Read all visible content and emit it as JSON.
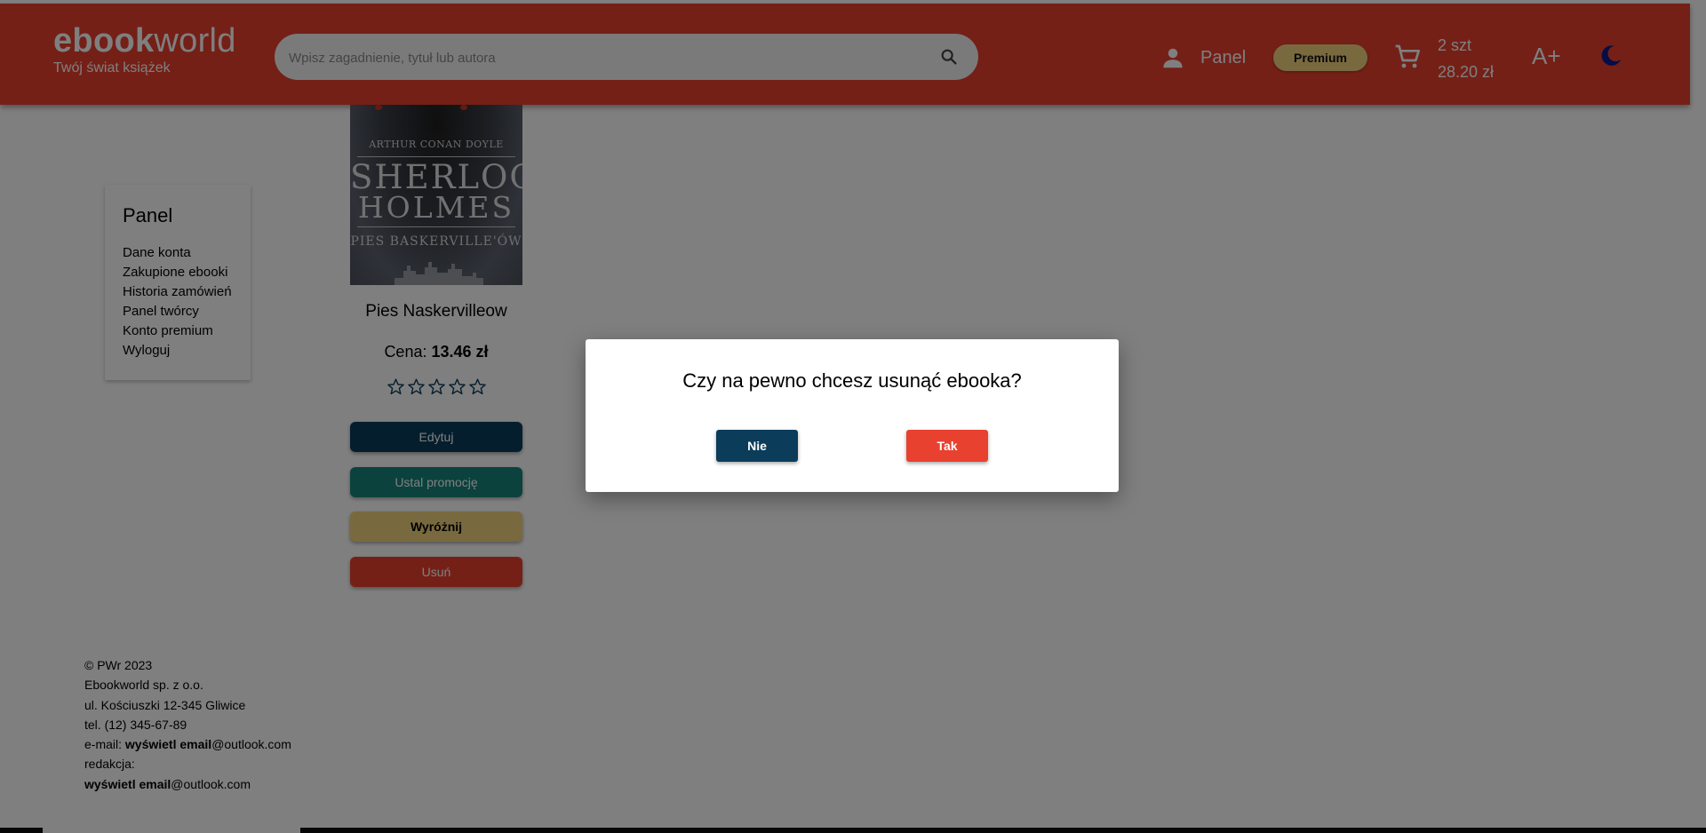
{
  "header": {
    "logo_bold": "ebook",
    "logo_light": "world",
    "tagline": "Twój świat książek",
    "search_placeholder": "Wpisz zagadnienie, tytuł lub autora",
    "panel_label": "Panel",
    "premium_label": "Premium",
    "cart_count": "2 szt",
    "cart_total": "28.20 zł",
    "font_size_label": "A+",
    "colors": {
      "bar": "#e8412f",
      "premium": "#f3d37e"
    }
  },
  "side_panel": {
    "title": "Panel",
    "items": [
      "Dane konta",
      "Zakupione ebooki",
      "Historia zamówień",
      "Panel twórcy",
      "Konto premium",
      "Wyloguj"
    ]
  },
  "book": {
    "cover_author": "ARTHUR CONAN DOYLE",
    "cover_title_1": "SHERLOCK",
    "cover_title_2": "HOLMES",
    "cover_subtitle": "PIES BASKERVILLE'ÓW",
    "title": "Pies Naskervilleow",
    "price_label": "Cena:",
    "price_value": "13.46 zł",
    "rating": 0,
    "rating_max": 5,
    "buttons": {
      "edit": "Edytuj",
      "promo": "Ustal promocję",
      "highlight": "Wyróżnij",
      "delete": "Usuń"
    }
  },
  "footer": {
    "copyright": "© PWr 2023",
    "company": "Ebookworld sp. z o.o.",
    "address": "ul. Kościuszki 12-345 Gliwice",
    "phone": "tel. (12) 345-67-89",
    "email_prefix": "e-mail: ",
    "email_bold": "wyświetl email",
    "email_domain": "@outlook.com",
    "editorial_label": "redakcja:",
    "editorial_bold": "wyświetl email",
    "editorial_domain": "@outlook.com"
  },
  "modal": {
    "question": "Czy na pewno chcesz usunąć ebooka?",
    "no_label": "Nie",
    "yes_label": "Tak"
  }
}
